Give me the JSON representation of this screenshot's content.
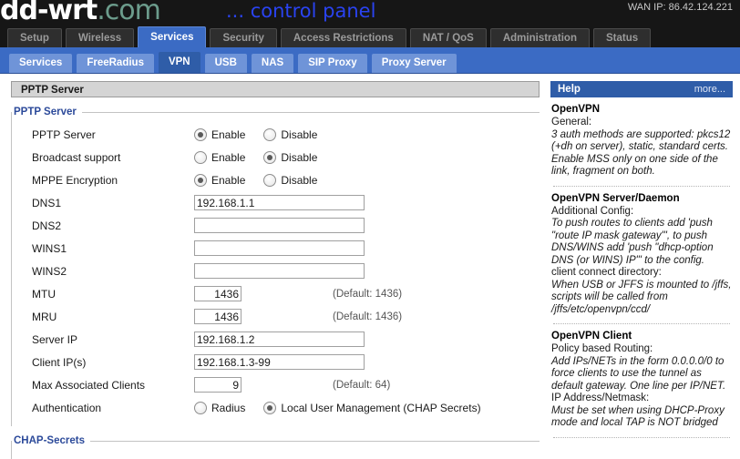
{
  "header": {
    "logo_brand": "dd-wrt",
    "logo_suffix": ".com",
    "control_panel": "... control panel",
    "wan_ip": "WAN IP: 86.42.124.221"
  },
  "main_tabs": [
    {
      "label": "Setup",
      "active": false
    },
    {
      "label": "Wireless",
      "active": false
    },
    {
      "label": "Services",
      "active": true
    },
    {
      "label": "Security",
      "active": false
    },
    {
      "label": "Access Restrictions",
      "active": false
    },
    {
      "label": "NAT / QoS",
      "active": false
    },
    {
      "label": "Administration",
      "active": false
    },
    {
      "label": "Status",
      "active": false
    }
  ],
  "sub_tabs": [
    {
      "label": "Services",
      "active": false
    },
    {
      "label": "FreeRadius",
      "active": false
    },
    {
      "label": "VPN",
      "active": true
    },
    {
      "label": "USB",
      "active": false
    },
    {
      "label": "NAS",
      "active": false
    },
    {
      "label": "SIP Proxy",
      "active": false
    },
    {
      "label": "Proxy Server",
      "active": false
    }
  ],
  "panel": {
    "title": "PPTP Server",
    "legend": "PPTP Server",
    "rows": {
      "pptp_server": {
        "label": "PPTP Server",
        "enable_label": "Enable",
        "disable_label": "Disable",
        "value": "Enable"
      },
      "broadcast_support": {
        "label": "Broadcast support",
        "enable_label": "Enable",
        "disable_label": "Disable",
        "value": "Disable"
      },
      "mppe_encryption": {
        "label": "MPPE Encryption",
        "enable_label": "Enable",
        "disable_label": "Disable",
        "value": "Enable"
      },
      "dns1": {
        "label": "DNS1",
        "value": "192.168.1.1"
      },
      "dns2": {
        "label": "DNS2",
        "value": ""
      },
      "wins1": {
        "label": "WINS1",
        "value": ""
      },
      "wins2": {
        "label": "WINS2",
        "value": ""
      },
      "mtu": {
        "label": "MTU",
        "value": "1436",
        "note": "(Default: 1436)"
      },
      "mru": {
        "label": "MRU",
        "value": "1436",
        "note": "(Default: 1436)"
      },
      "server_ip": {
        "label": "Server IP",
        "value": "192.168.1.2"
      },
      "client_ips": {
        "label": "Client IP(s)",
        "value": "192.168.1.3-99"
      },
      "max_clients": {
        "label": "Max Associated Clients",
        "value": "9",
        "note": "(Default: 64)"
      },
      "authentication": {
        "label": "Authentication",
        "radius_label": "Radius",
        "local_label": "Local User Management (CHAP Secrets)",
        "value": "Local User Management (CHAP Secrets)"
      }
    }
  },
  "chap_secrets": {
    "legend": "CHAP-Secrets"
  },
  "help": {
    "title": "Help",
    "more": "more...",
    "sections": [
      {
        "heading": "OpenVPN",
        "plain": "General:",
        "italic": "3 auth methods are supported: pkcs12 (+dh on server), static, standard certs. Enable MSS only on one side of the link, fragment on both."
      },
      {
        "heading": "OpenVPN Server/Daemon",
        "plain": "Additional Config:",
        "italic": "To push routes to clients add 'push \"route IP mask gateway\"', to push DNS/WINS add 'push \"dhcp-option DNS (or WINS) IP\"' to the config.",
        "plain2": "client connect directory:",
        "italic2": "When USB or JFFS is mounted to /jffs, scripts will be called from /jffs/etc/openvpn/ccd/"
      },
      {
        "heading": "OpenVPN Client",
        "plain": "Policy based Routing:",
        "italic": "Add IPs/NETs in the form 0.0.0.0/0 to force clients to use the tunnel as default gateway. One line per IP/NET.",
        "plain3": "IP Address/Netmask:",
        "italic3": "Must be set when using DHCP-Proxy mode and local TAP is NOT bridged"
      }
    ]
  }
}
